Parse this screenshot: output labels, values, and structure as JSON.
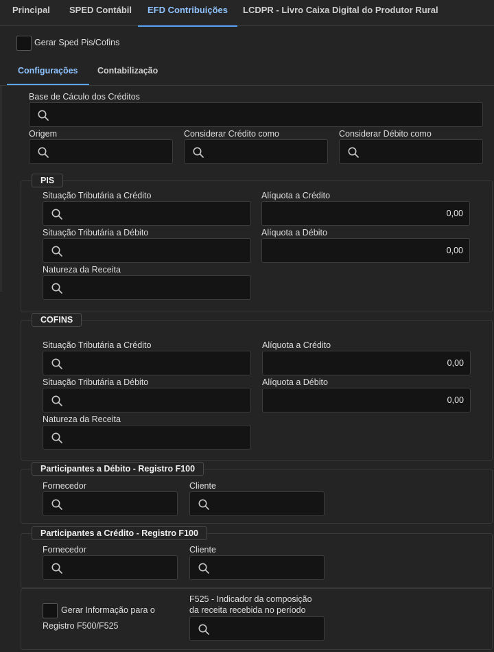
{
  "tabs": [
    "Principal",
    "SPED Contábil",
    "EFD Contribuições",
    "LCDPR - Livro Caixa Digital do Produtor Rural"
  ],
  "gerar_sped_label": "Gerar Sped Pis/Cofins",
  "subtabs": [
    "Configurações",
    "Contabilização"
  ],
  "base_calculo": {
    "label": "Base de Cáculo dos Créditos"
  },
  "origem": {
    "label": "Origem"
  },
  "considerar_credito": {
    "label": "Considerar Crédito como"
  },
  "considerar_debito": {
    "label": "Considerar Débito como"
  },
  "pis": {
    "title": "PIS",
    "sit_credito_label": "Situação Tributária a Crédito",
    "aliq_credito_label": "Alíquota a Crédito",
    "aliq_credito_value": "0,00",
    "sit_debito_label": "Situação Tributária a Débito",
    "aliq_debito_label": "Alíquota a Débito",
    "aliq_debito_value": "0,00",
    "natureza_label": "Natureza da Receita"
  },
  "cofins": {
    "title": "COFINS",
    "sit_credito_label": "Situação Tributária a Crédito",
    "aliq_credito_label": "Alíquota a Crédito",
    "aliq_credito_value": "0,00",
    "sit_debito_label": "Situação Tributária a Débito",
    "aliq_debito_label": "Alíquota a Débito",
    "aliq_debito_value": "0,00",
    "natureza_label": "Natureza da Receita"
  },
  "part_debito": {
    "title": "Participantes a Débito - Registro F100",
    "fornecedor_label": "Fornecedor",
    "cliente_label": "Cliente"
  },
  "part_credito": {
    "title": "Participantes a Crédito - Registro F100",
    "fornecedor_label": "Fornecedor",
    "cliente_label": "Cliente"
  },
  "f500": {
    "gerar_label_line1": "Gerar Informação para o",
    "gerar_label_line2": "Registro F500/F525",
    "f525_label_line1": "F525 - Indicador da composição",
    "f525_label_line2": "da receita recebida no período"
  },
  "colors": {
    "accent": "#5aa5f5",
    "active_text": "#8fc3ff",
    "background": "#242424",
    "field_bg": "#141414"
  },
  "icons": {
    "search": "search-icon"
  }
}
